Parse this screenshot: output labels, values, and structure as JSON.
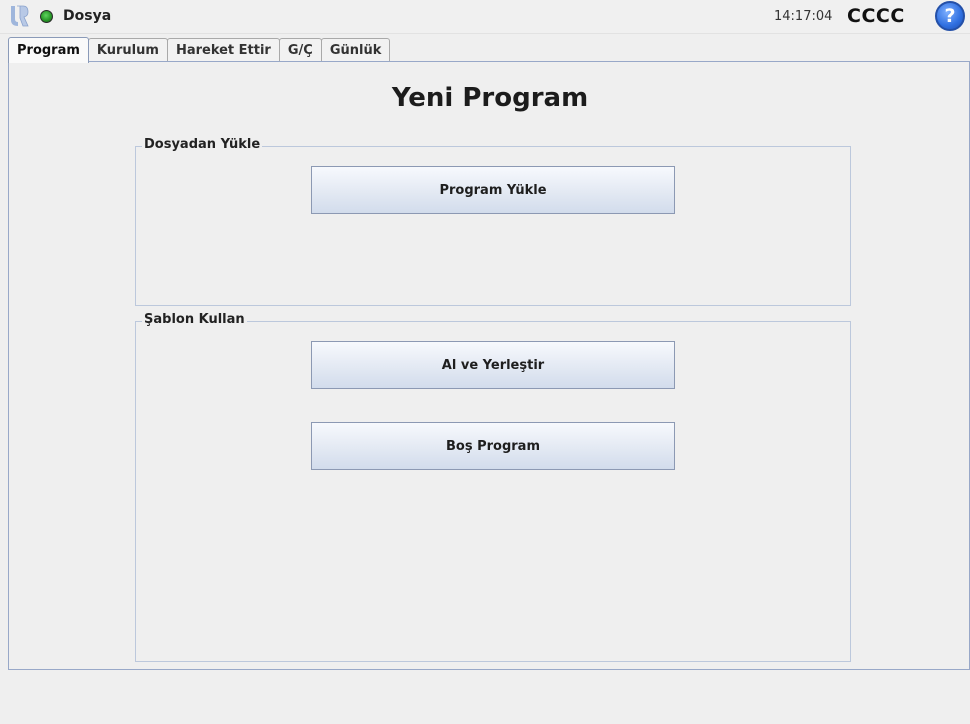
{
  "titlebar": {
    "app_name": "Dosya",
    "time": "14:17:04",
    "robot_name": "CCCC",
    "help_symbol": "?",
    "logo_icon": "ur-logo-icon",
    "status_color": "#2a9a2a"
  },
  "tabs": [
    {
      "label": "Program",
      "active": true
    },
    {
      "label": "Kurulum",
      "active": false
    },
    {
      "label": "Hareket Ettir",
      "active": false
    },
    {
      "label": "G/Ç",
      "active": false
    },
    {
      "label": "Günlük",
      "active": false
    }
  ],
  "main": {
    "title": "Yeni Program",
    "load_group": {
      "label": "Dosyadan Yükle",
      "load_button": "Program Yükle"
    },
    "template_group": {
      "label": "Şablon Kullan",
      "pick_place_button": "Al ve Yerleştir",
      "empty_program_button": "Boş Program"
    }
  },
  "colors": {
    "accent": "#2f6fe0",
    "panel_border": "#98a8c8",
    "button_gradient_top": "#f7f9fd",
    "button_gradient_bottom": "#d2dcec"
  }
}
